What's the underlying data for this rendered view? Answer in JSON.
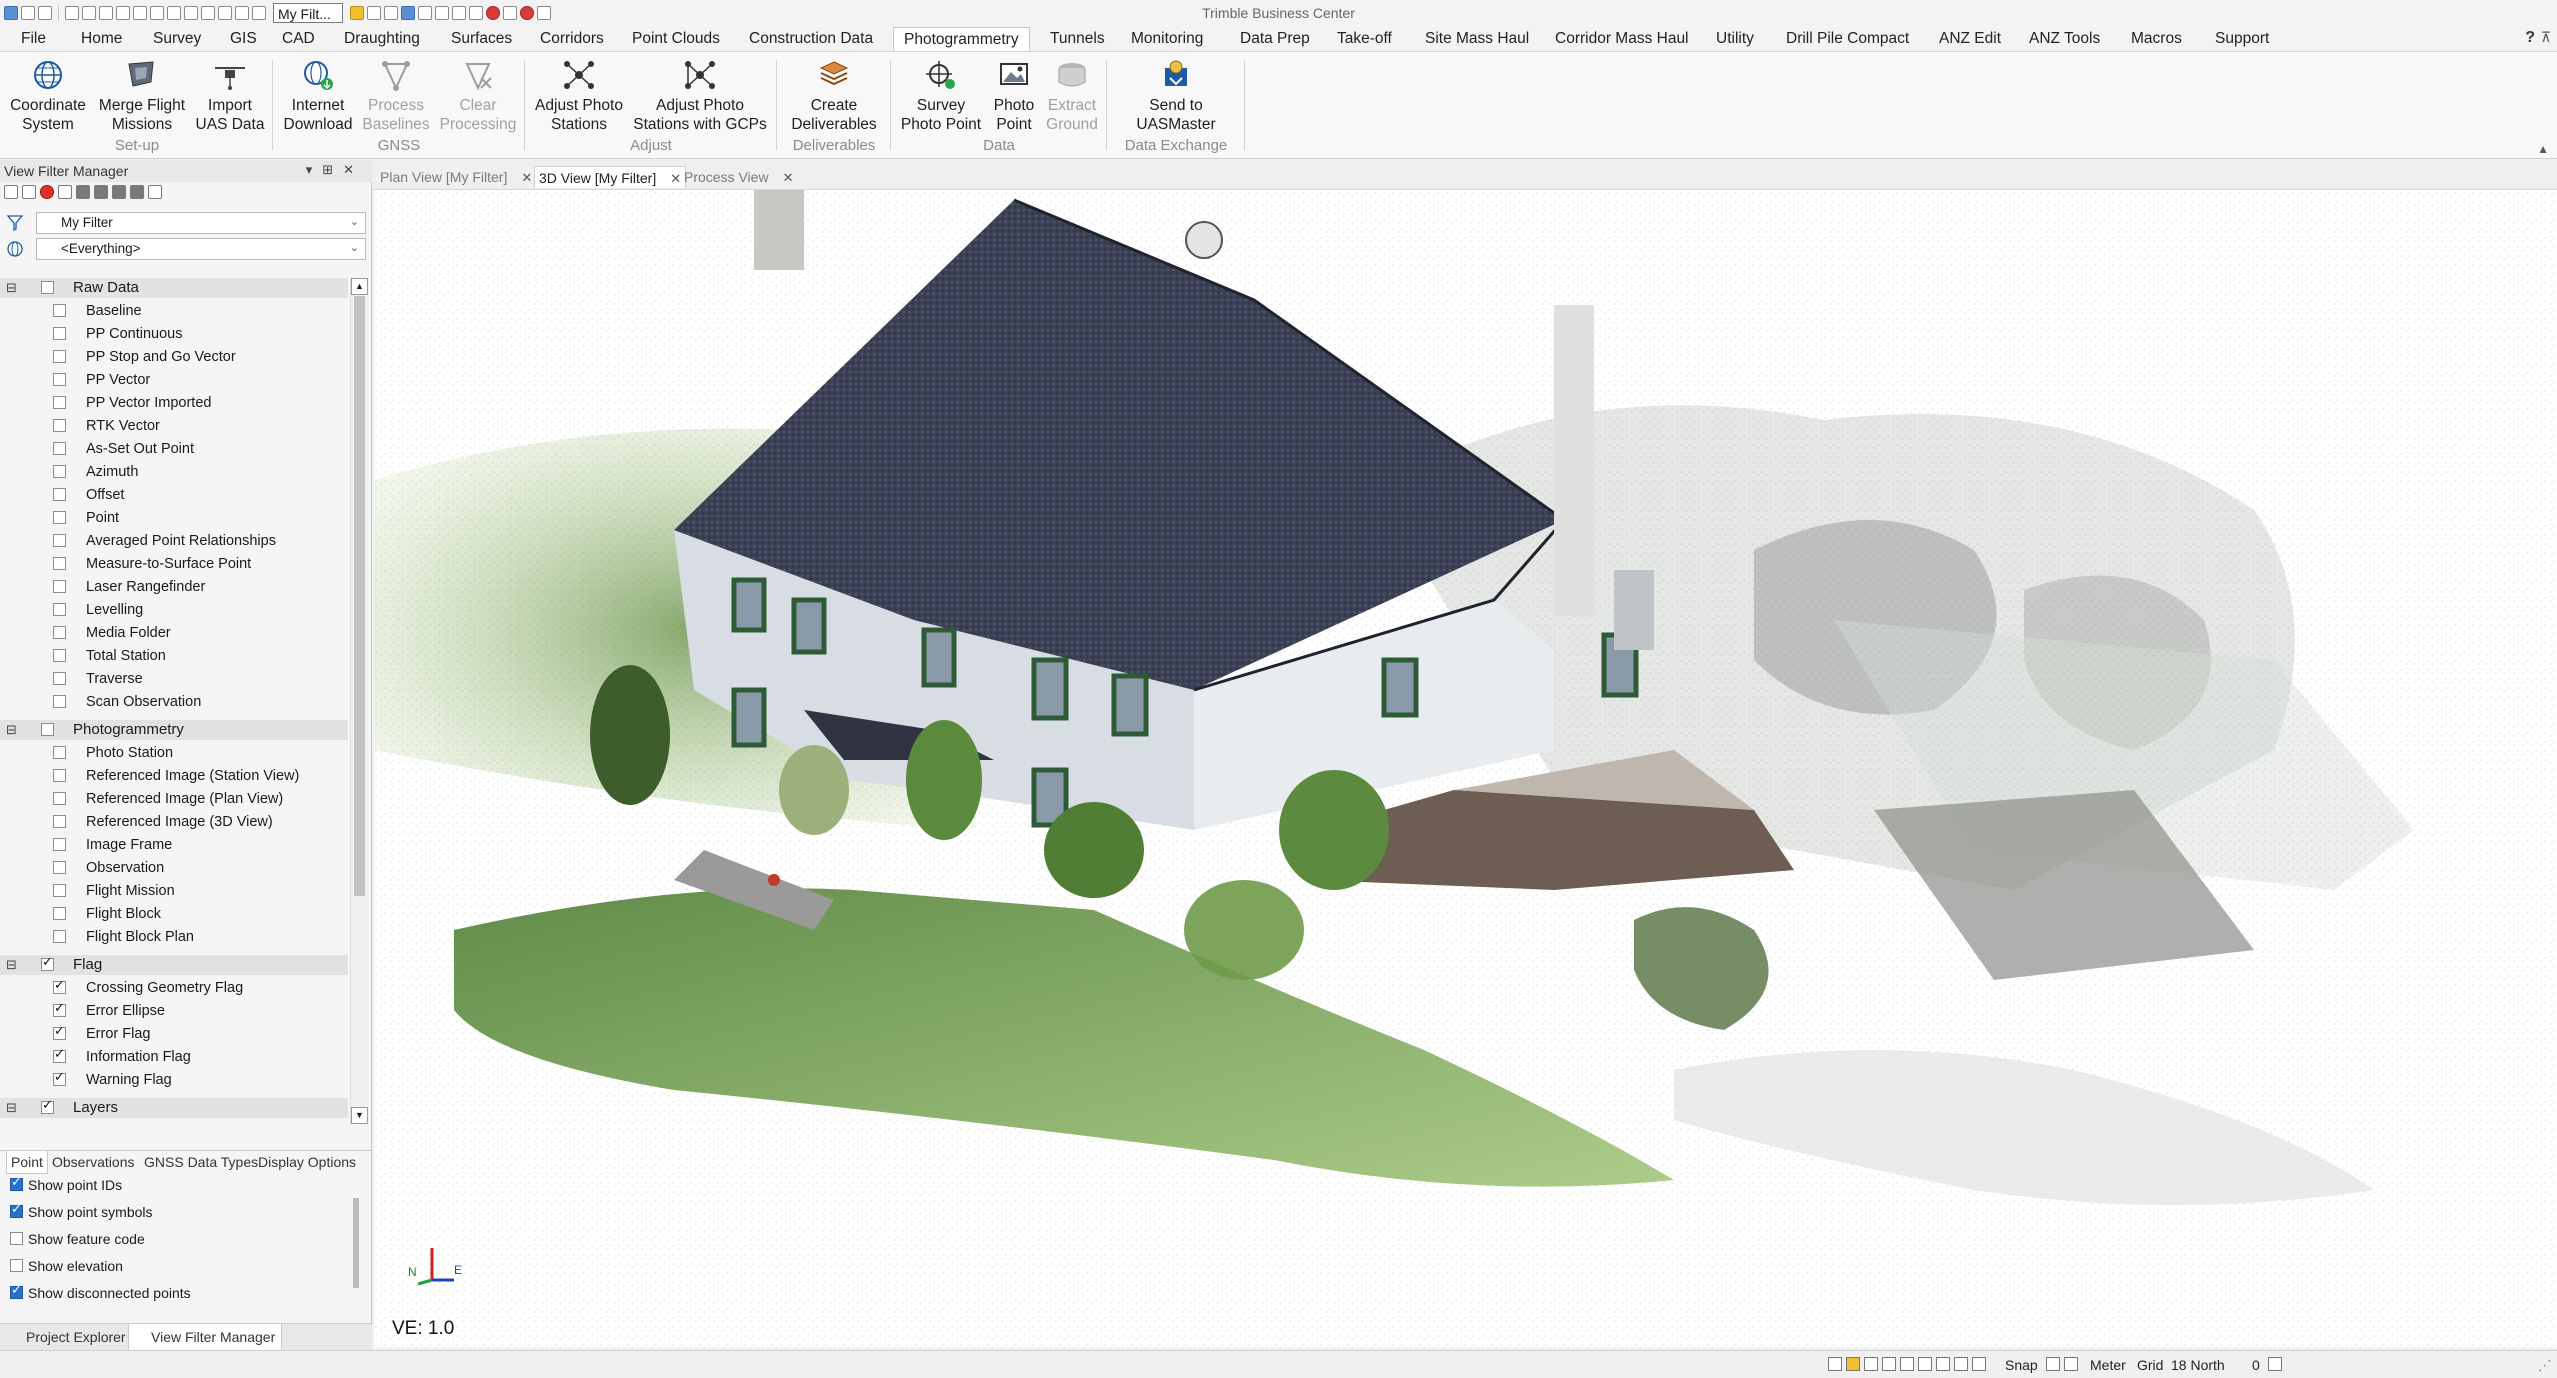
{
  "app": {
    "title": "Trimble Business Center",
    "quick_filter_value": "My Filt..."
  },
  "menu": {
    "file": "File",
    "tabs": [
      "Home",
      "Survey",
      "GIS",
      "CAD",
      "Draughting",
      "Surfaces",
      "Corridors",
      "Point Clouds",
      "Construction Data",
      "Photogrammetry",
      "Tunnels",
      "Monitoring",
      "Data Prep",
      "Take-off",
      "Site Mass Haul",
      "Corridor Mass Haul",
      "Utility",
      "Drill Pile Compact",
      "ANZ Edit",
      "ANZ Tools",
      "Macros",
      "Support"
    ],
    "active_tab": "Photogrammetry",
    "help": "?"
  },
  "ribbon": {
    "coordinate_system": [
      "Coordinate",
      "System"
    ],
    "merge_flight": [
      "Merge Flight",
      "Missions"
    ],
    "import_uas": [
      "Import",
      "UAS Data"
    ],
    "setup_label": "Set-up",
    "internet_download": [
      "Internet",
      "Download"
    ],
    "process_baselines": [
      "Process",
      "Baselines"
    ],
    "clear_processing": [
      "Clear",
      "Processing"
    ],
    "gnss_label": "GNSS",
    "adjust_photo": [
      "Adjust Photo",
      "Stations"
    ],
    "adjust_photo_gcps": [
      "Adjust Photo",
      "Stations with GCPs"
    ],
    "adjust_label": "Adjust",
    "create_deliverables": [
      "Create",
      "Deliverables"
    ],
    "deliverables_label": "Deliverables",
    "survey_photo_point": [
      "Survey",
      "Photo Point"
    ],
    "photo_point": [
      "Photo",
      "Point"
    ],
    "extract_ground": [
      "Extract",
      "Ground"
    ],
    "data_label": "Data",
    "send_uasmaster": [
      "Send to",
      "UASMaster"
    ],
    "data_exchange_label": "Data Exchange"
  },
  "panel": {
    "title": "View Filter Manager",
    "filter_select": "My Filter",
    "scope_select": "<Everything>",
    "categories": [
      {
        "name": "Raw Data",
        "checked": false,
        "items": [
          {
            "label": "Baseline",
            "checked": false
          },
          {
            "label": "PP Continuous",
            "checked": false
          },
          {
            "label": "PP Stop and Go Vector",
            "checked": false
          },
          {
            "label": "PP Vector",
            "checked": false
          },
          {
            "label": "PP Vector Imported",
            "checked": false
          },
          {
            "label": "RTK Vector",
            "checked": false
          },
          {
            "label": "As-Set Out Point",
            "checked": false
          },
          {
            "label": "Azimuth",
            "checked": false
          },
          {
            "label": "Offset",
            "checked": false
          },
          {
            "label": "Point",
            "checked": false
          },
          {
            "label": "Averaged Point Relationships",
            "checked": false
          },
          {
            "label": "Measure-to-Surface Point",
            "checked": false
          },
          {
            "label": "Laser Rangefinder",
            "checked": false
          },
          {
            "label": "Levelling",
            "checked": false
          },
          {
            "label": "Media Folder",
            "checked": false
          },
          {
            "label": "Total Station",
            "checked": false
          },
          {
            "label": "Traverse",
            "checked": false
          },
          {
            "label": "Scan Observation",
            "checked": false
          }
        ]
      },
      {
        "name": "Photogrammetry",
        "checked": false,
        "items": [
          {
            "label": "Photo Station",
            "checked": false
          },
          {
            "label": "Referenced Image (Station View)",
            "checked": false
          },
          {
            "label": "Referenced Image (Plan View)",
            "checked": false
          },
          {
            "label": "Referenced Image (3D View)",
            "checked": false
          },
          {
            "label": "Image Frame",
            "checked": false
          },
          {
            "label": "Observation",
            "checked": false
          },
          {
            "label": "Flight Mission",
            "checked": false
          },
          {
            "label": "Flight Block",
            "checked": false
          },
          {
            "label": "Flight Block Plan",
            "checked": false
          }
        ]
      },
      {
        "name": "Flag",
        "checked": true,
        "items": [
          {
            "label": "Crossing Geometry Flag",
            "checked": true
          },
          {
            "label": "Error Ellipse",
            "checked": true
          },
          {
            "label": "Error Flag",
            "checked": true
          },
          {
            "label": "Information Flag",
            "checked": true
          },
          {
            "label": "Warning Flag",
            "checked": true
          }
        ]
      },
      {
        "name": "Layers",
        "checked": true,
        "items": []
      }
    ],
    "option_tabs": [
      "Point",
      "Observations",
      "GNSS Data Types",
      "Display Options"
    ],
    "options": [
      {
        "label": "Show point IDs",
        "checked": true
      },
      {
        "label": "Show point symbols",
        "checked": true
      },
      {
        "label": "Show feature code",
        "checked": false
      },
      {
        "label": "Show elevation",
        "checked": false
      },
      {
        "label": "Show disconnected points",
        "checked": true
      }
    ],
    "bottom_tabs": [
      "Project Explorer",
      "View Filter Manager"
    ]
  },
  "doc_tabs": [
    {
      "label": "Plan View [My Filter]",
      "active": false
    },
    {
      "label": "3D View [My Filter]",
      "active": true
    },
    {
      "label": "Process View",
      "active": false
    }
  ],
  "viewport": {
    "ve_label": "VE: 1.0",
    "triad_n": "N",
    "triad_e": "E"
  },
  "status": {
    "snap": "Snap",
    "units": "Meter",
    "grid": "Grid",
    "orientation": "18 North",
    "count": "0"
  },
  "colors": {
    "accent": "#2a6fc9",
    "roof": "#3a3f52",
    "siding": "#e6eaee",
    "shutter": "#2e5a38",
    "grass": "#6f9a48"
  }
}
